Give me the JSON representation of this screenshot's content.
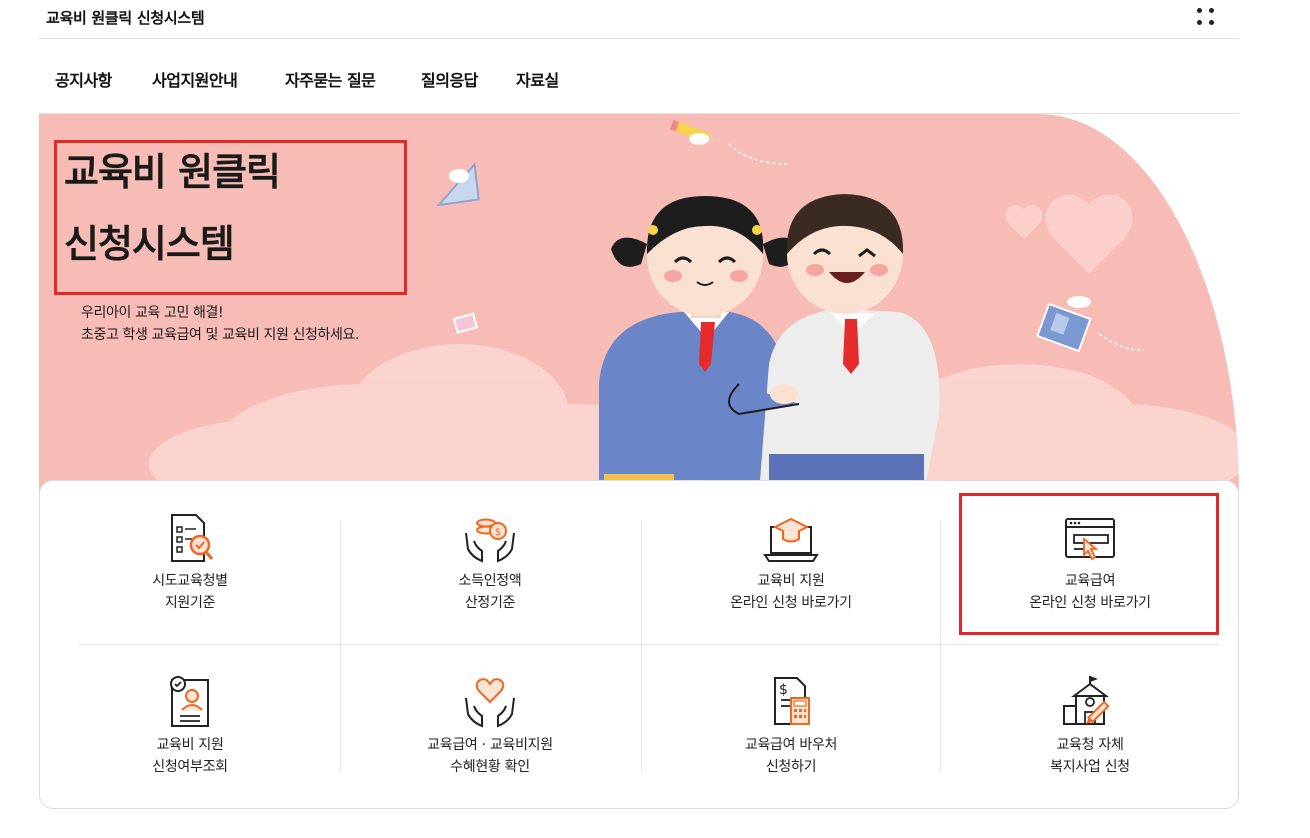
{
  "header": {
    "site_title": "교육비 원클릭 신청시스템",
    "menu_icon": "dots-grid-icon"
  },
  "nav": {
    "items": [
      {
        "label": "공지사항"
      },
      {
        "label": "사업지원안내"
      },
      {
        "label": "자주묻는 질문"
      },
      {
        "label": "질의응답"
      },
      {
        "label": "자료실"
      }
    ]
  },
  "hero": {
    "title_line1": "교육비 원클릭",
    "title_line2": "신청시스템",
    "subtitle_line1": "우리아이 교육 고민 해결!",
    "subtitle_line2": "초중고 학생 교육급여 및 교육비 지원 신청하세요.",
    "background_color": "#f7bcb6"
  },
  "services": [
    {
      "line1": "시도교육청별",
      "line2": "지원기준",
      "icon": "document-search-icon"
    },
    {
      "line1": "소득인정액",
      "line2": "산정기준",
      "icon": "hands-coins-icon"
    },
    {
      "line1": "교육비 지원",
      "line2": "온라인 신청 바로가기",
      "icon": "laptop-graduation-icon"
    },
    {
      "line1": "교육급여",
      "line2": "온라인 신청 바로가기",
      "icon": "browser-click-icon"
    },
    {
      "line1": "교육비 지원",
      "line2": "신청여부조회",
      "icon": "profile-check-icon"
    },
    {
      "line1": "교육급여 · 교육비지원",
      "line2": "수혜현황 확인",
      "icon": "hands-heart-icon"
    },
    {
      "line1": "교육급여 바우처",
      "line2": "신청하기",
      "icon": "invoice-calculator-icon"
    },
    {
      "line1": "교육청 자체",
      "line2": "복지사업 신청",
      "icon": "school-pencil-icon"
    }
  ],
  "colors": {
    "accent": "#f26522",
    "highlight": "#e5262a",
    "icon_line": "#222222"
  }
}
